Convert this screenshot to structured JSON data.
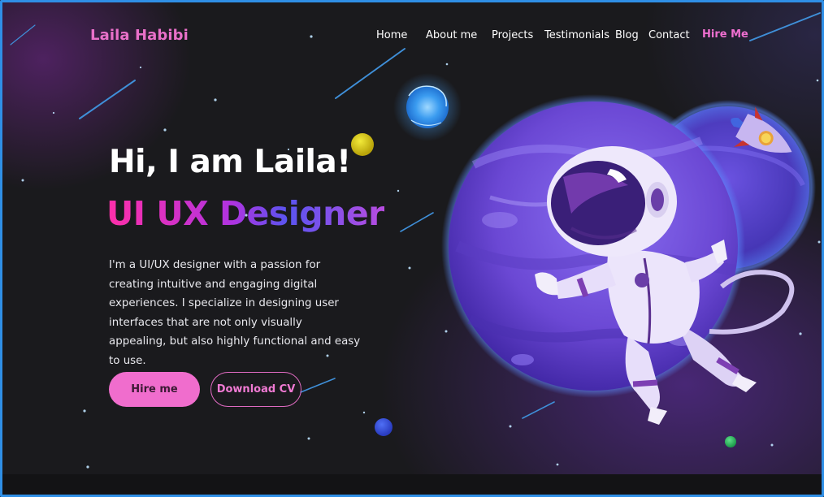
{
  "brand": {
    "name": "Laila Habibi",
    "color": "#e970c9"
  },
  "nav": {
    "items": [
      {
        "label": "Home"
      },
      {
        "label": "About me"
      },
      {
        "label": "Projects"
      },
      {
        "label": "Testimonials"
      },
      {
        "label": "Blog"
      },
      {
        "label": "Contact"
      }
    ],
    "cta": "Hire Me"
  },
  "hero": {
    "greeting": "Hi, I am Laila!",
    "role": "UI UX Designer",
    "bio": "I'm a UI/UX designer with a passion for creating intuitive and engaging digital experiences. I specialize in designing user interfaces that are not only visually appealing, but also highly functional and easy to use.",
    "primary_button": "Hire me",
    "secondary_button": "Download CV"
  },
  "illustration": {
    "icons": [
      "astronaut-icon",
      "purple-planet-icon",
      "rocket-icon",
      "blue-sun-icon",
      "yellow-planet-icon",
      "blue-moon-icon",
      "green-moon-icon"
    ]
  },
  "colors": {
    "accent": "#f06dcd",
    "frame": "#2f8fe6",
    "background": "#1a1a1d",
    "gradient": [
      "#ff2fa8",
      "#b033e0",
      "#5a54f0"
    ]
  }
}
